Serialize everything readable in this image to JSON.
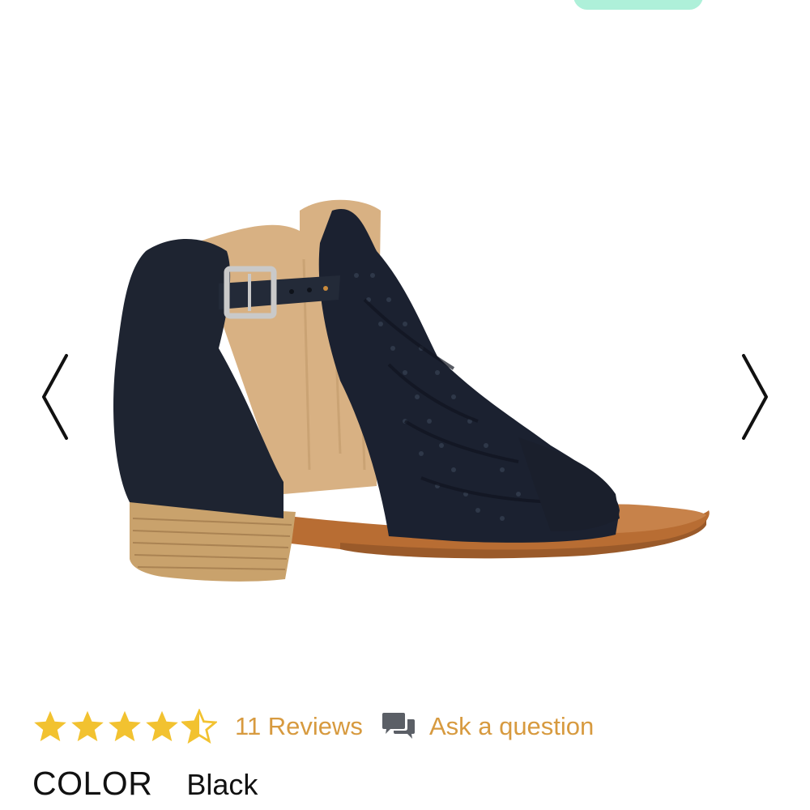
{
  "product": {
    "image_alt": "Black perforated leather open-toe ankle bootie with buckle strap and stacked wood heel",
    "rating": 4.5,
    "rating_max": 5,
    "reviews_label": "11 Reviews",
    "ask_label": "Ask a question",
    "color_label": "COLOR",
    "color_value": "Black"
  },
  "colors": {
    "star": "#f2c230",
    "link": "#d79a3f",
    "top_pill": "#aef0d9"
  },
  "icons": {
    "prev": "chevron-left-icon",
    "next": "chevron-right-icon",
    "ask": "chat-bubbles-icon",
    "star": "star-icon"
  }
}
